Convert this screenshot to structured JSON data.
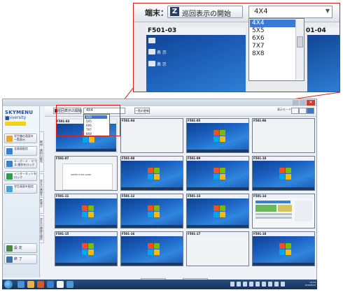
{
  "callout": {
    "label": "端末：",
    "start_button": "巡回表示の開始",
    "layout_value": "4X4",
    "options": [
      "4X4",
      "5X5",
      "6X6",
      "7X7",
      "8X8"
    ],
    "selected_option": "4X4",
    "tile1_name": "F501-03",
    "tile2_name": "01-04",
    "tile_icon_labels": [
      "",
      "表 示",
      "表 示"
    ]
  },
  "app": {
    "logo_line1": "SKYMENU ■",
    "logo_line2": "University",
    "sidebar_items": [
      {
        "label": "学生機の画面を 一覧表示",
        "color": "#e8a33a"
      },
      {
        "label": "全画面配信",
        "color": "#3b7fd0"
      },
      {
        "label": "キーボード・マウス 操作をロック",
        "color": "#3b7fd0"
      },
      {
        "label": "インターネットを ロック",
        "color": "#2f9e4f"
      },
      {
        "label": "学生画面を配信",
        "color": "#46a3d6"
      }
    ],
    "sidebar_bottom": [
      {
        "label": "設 定",
        "color": "#4a8a3a"
      },
      {
        "label": "終 了",
        "color": "#3b6fb0"
      }
    ],
    "vertical_tabs": [
      "教材・資料の配布",
      "学生の画面を一覧表示",
      "学生の画面を操作"
    ],
    "toolbar": {
      "start_button": "巡回表示の開始",
      "layout_value": "4X4",
      "options": [
        "4X4",
        "5X5",
        "6X6",
        "7X7",
        "8X8"
      ],
      "button2": "一覧の更新",
      "right_label": "表示モード"
    },
    "tiles": [
      {
        "name": "F501-03",
        "kind": "win7",
        "selected": true
      },
      {
        "name": "F501-04",
        "kind": "white"
      },
      {
        "name": "F501-05",
        "kind": "win7"
      },
      {
        "name": "F501-06",
        "kind": "white"
      },
      {
        "name": "F501-07",
        "kind": "ppt"
      },
      {
        "name": "F501-08",
        "kind": "win7"
      },
      {
        "name": "F501-09",
        "kind": "win7"
      },
      {
        "name": "F501-10",
        "kind": "win7"
      },
      {
        "name": "F501-11",
        "kind": "win7"
      },
      {
        "name": "F501-12",
        "kind": "win7"
      },
      {
        "name": "F501-13",
        "kind": "win7"
      },
      {
        "name": "F501-14",
        "kind": "web"
      },
      {
        "name": "F501-15",
        "kind": "win7"
      },
      {
        "name": "F501-16",
        "kind": "win7"
      },
      {
        "name": "F501-17",
        "kind": "white"
      },
      {
        "name": "F501-18",
        "kind": "win7"
      }
    ],
    "ppt_text": "PREFECTURE NAME",
    "bottom_buttons": [
      "画面配信",
      "終 了"
    ],
    "clock": "13:24\n2016/8/22"
  }
}
